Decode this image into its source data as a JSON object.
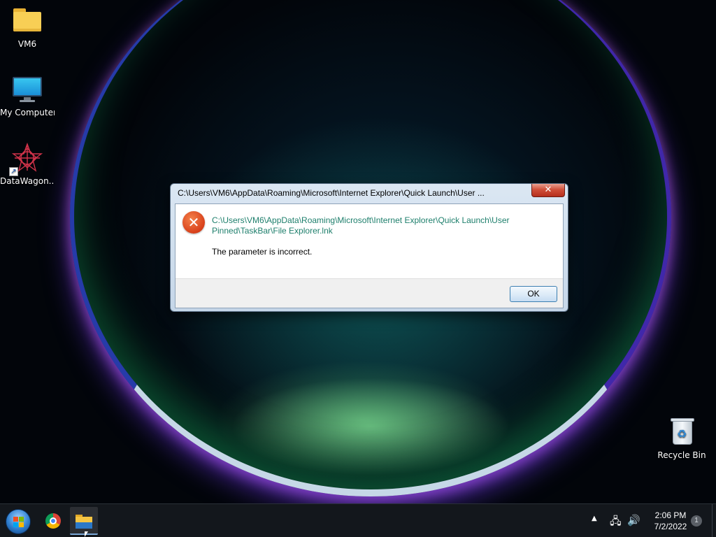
{
  "desktop": {
    "icons": [
      {
        "label": "VM6",
        "icon": "folder-icon"
      },
      {
        "label": "My Computer",
        "icon": "computer-icon"
      },
      {
        "label": "DataWagon...",
        "icon": "datawagon-icon"
      },
      {
        "label": "Recycle Bin",
        "icon": "recycle-bin-icon"
      }
    ]
  },
  "dialog": {
    "title": "C:\\Users\\VM6\\AppData\\Roaming\\Microsoft\\Internet Explorer\\Quick Launch\\User ...",
    "close_symbol": "✕",
    "icon": "error-icon",
    "error_symbol": "✕",
    "path_line1": "C:\\Users\\VM6\\AppData\\Roaming\\Microsoft\\Internet Explorer\\Quick Launch\\User",
    "path_line2": "Pinned\\TaskBar\\File Explorer.lnk",
    "message": "The parameter is incorrect.",
    "ok_label": "OK",
    "colors": {
      "path_text": "#1e7f6c",
      "error_icon": "#d8401a",
      "close_button": "#c8432f"
    }
  },
  "taskbar": {
    "start": {
      "icon": "windows-start-icon"
    },
    "pinned": [
      {
        "name": "Google Chrome",
        "icon": "chrome-icon",
        "active": false
      },
      {
        "name": "File Explorer",
        "icon": "file-explorer-icon",
        "active": true
      }
    ],
    "tray": {
      "chevron_symbol": "▲",
      "network_symbol": "🖧",
      "volume_symbol": "🔊",
      "time": "2:06 PM",
      "date": "7/2/2022",
      "notification_count": "1"
    }
  }
}
